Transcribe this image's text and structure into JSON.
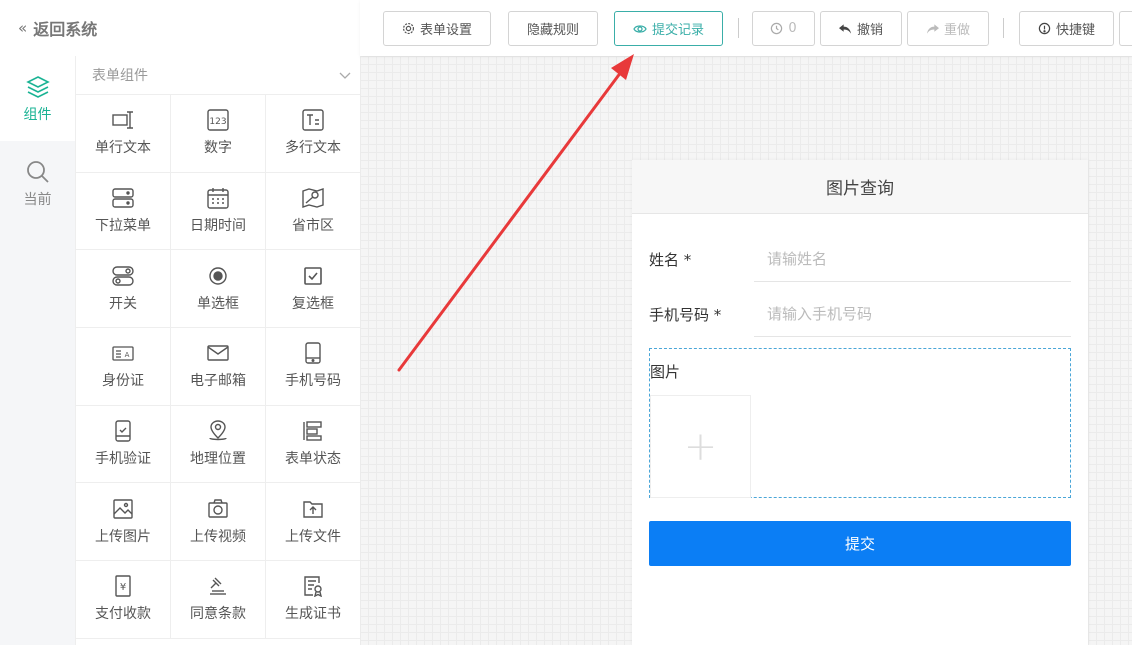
{
  "left": {
    "back_label": "返回系统",
    "rail": [
      {
        "label": "组件",
        "icon": "layers-icon",
        "active": true
      },
      {
        "label": "当前",
        "icon": "search-icon",
        "active": false
      }
    ],
    "section_title": "表单组件",
    "components": [
      {
        "label": "单行文本",
        "icon": "single-line-text-icon"
      },
      {
        "label": "数字",
        "icon": "number-icon"
      },
      {
        "label": "多行文本",
        "icon": "multi-line-text-icon"
      },
      {
        "label": "下拉菜单",
        "icon": "dropdown-icon"
      },
      {
        "label": "日期时间",
        "icon": "calendar-icon"
      },
      {
        "label": "省市区",
        "icon": "region-map-icon"
      },
      {
        "label": "开关",
        "icon": "toggle-icon"
      },
      {
        "label": "单选框",
        "icon": "radio-icon"
      },
      {
        "label": "复选框",
        "icon": "checkbox-icon"
      },
      {
        "label": "身份证",
        "icon": "id-card-icon"
      },
      {
        "label": "电子邮箱",
        "icon": "mail-icon"
      },
      {
        "label": "手机号码",
        "icon": "phone-icon"
      },
      {
        "label": "手机验证",
        "icon": "phone-verify-icon"
      },
      {
        "label": "地理位置",
        "icon": "location-icon"
      },
      {
        "label": "表单状态",
        "icon": "form-status-icon"
      },
      {
        "label": "上传图片",
        "icon": "upload-image-icon"
      },
      {
        "label": "上传视频",
        "icon": "upload-video-icon"
      },
      {
        "label": "上传文件",
        "icon": "upload-file-icon"
      },
      {
        "label": "支付收款",
        "icon": "payment-icon"
      },
      {
        "label": "同意条款",
        "icon": "gavel-icon"
      },
      {
        "label": "生成证书",
        "icon": "certificate-icon"
      }
    ]
  },
  "toolbar": {
    "form_settings": "表单设置",
    "hide_rules": "隐藏规则",
    "submit_records": "提交记录",
    "history_count": "0",
    "undo": "撤销",
    "redo": "重做",
    "shortcuts": "快捷键"
  },
  "form": {
    "title": "图片查询",
    "fields": [
      {
        "label": "姓名 *",
        "placeholder": "请输姓名"
      },
      {
        "label": "手机号码 *",
        "placeholder": "请输入手机号码"
      }
    ],
    "image_label": "图片",
    "upload_symbol": "+",
    "submit_label": "提交"
  },
  "colors": {
    "accent": "#3aaea8",
    "submit": "#0b7ef5",
    "annotation_arrow": "#e8393a"
  }
}
